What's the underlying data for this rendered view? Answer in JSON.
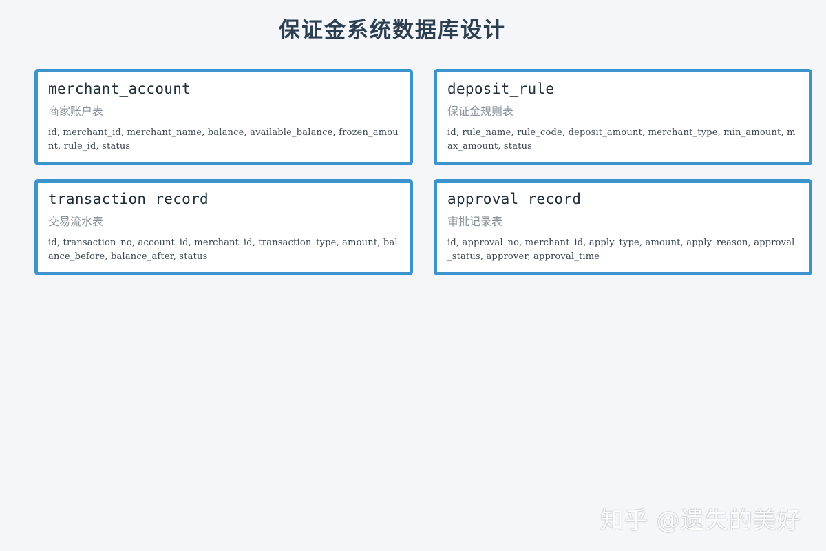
{
  "title": "保证金系统数据库设计",
  "tables": [
    {
      "name": "merchant_account",
      "description": "商家账户表",
      "fields": "id, merchant_id, merchant_name, balance, available_balance, frozen_amount, rule_id, status"
    },
    {
      "name": "deposit_rule",
      "description": "保证金规则表",
      "fields": "id, rule_name, rule_code, deposit_amount, merchant_type, min_amount, max_amount, status"
    },
    {
      "name": "transaction_record",
      "description": "交易流水表",
      "fields": "id, transaction_no, account_id, merchant_id, transaction_type, amount, balance_before, balance_after, status"
    },
    {
      "name": "approval_record",
      "description": "审批记录表",
      "fields": "id, approval_no, merchant_id, apply_type, amount, apply_reason, approval_status, approver, approval_time"
    }
  ],
  "watermark": "知乎 @遗失的美好",
  "colors": {
    "background": "#f4f6fa",
    "card_border": "#3d93cc",
    "title": "#2c3e50",
    "description": "#8a949c"
  }
}
